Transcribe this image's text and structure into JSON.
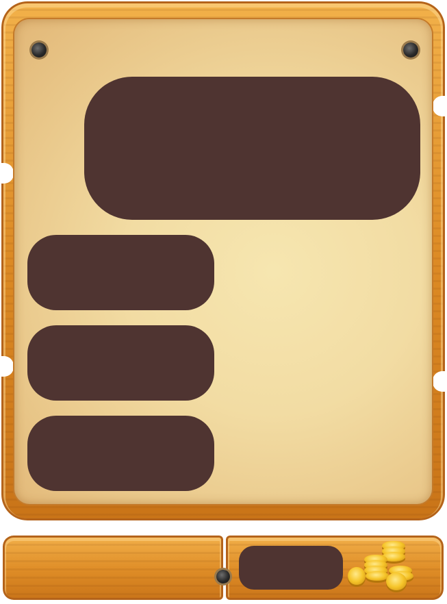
{
  "screen": {
    "title": "",
    "colors": {
      "wood": "#de8c26",
      "parchment": "#f2dca3",
      "panel": "#4f3431",
      "bolt": "#2a2a2a",
      "coin": "#f6c52a"
    }
  },
  "main_panel": {
    "text": ""
  },
  "menu_buttons": [
    {
      "label": ""
    },
    {
      "label": ""
    },
    {
      "label": ""
    }
  ],
  "footer": {
    "coin_value": "",
    "coin_icon": "gold-coin-stack-icon"
  }
}
